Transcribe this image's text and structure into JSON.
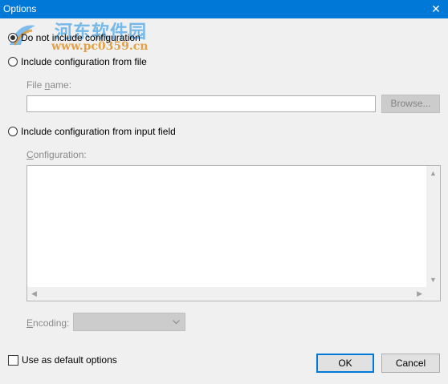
{
  "window": {
    "title": "Options",
    "close_glyph": "✕"
  },
  "watermark": {
    "cn_text": "河东软件园",
    "url_text": "www.pc0359.cn"
  },
  "options": {
    "no_config": "Do not include configuration",
    "from_file": "Include configuration from file",
    "from_input": "Include configuration from input field",
    "selected": "no_config"
  },
  "file": {
    "label_prefix": "File ",
    "label_underlined": "n",
    "label_suffix": "ame:",
    "value": "",
    "browse_label": "Browse..."
  },
  "configuration": {
    "label_underlined": "C",
    "label_suffix": "onfiguration:",
    "value": ""
  },
  "encoding": {
    "label_underlined": "E",
    "label_suffix": "ncoding:",
    "selected_value": ""
  },
  "footer": {
    "default_checkbox_label": "Use as default options",
    "default_checked": false,
    "ok_label": "OK",
    "cancel_label": "Cancel"
  },
  "colors": {
    "titlebar": "#0078d7",
    "dialog_bg": "#f0f0f0"
  }
}
